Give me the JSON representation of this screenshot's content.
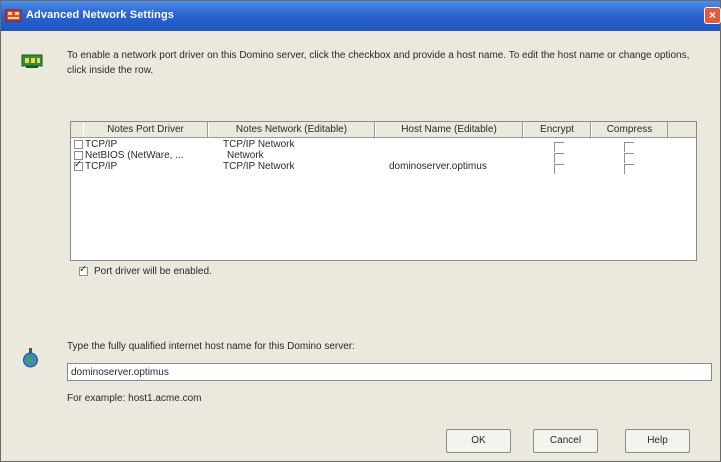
{
  "window": {
    "title": "Advanced Network Settings",
    "close_glyph": "×"
  },
  "intro_text": "To enable a network port driver on this Domino server, click the checkbox and provide a host name. To edit the host name or change options, click inside the row.",
  "table": {
    "headers": [
      "Notes Port Driver",
      "Notes Network (Editable)",
      "Host Name (Editable)",
      "Encrypt",
      "Compress"
    ],
    "rows": [
      {
        "driver": "TCP/IP",
        "network": "TCP/IP Network",
        "host": "",
        "enabled": false,
        "encrypt": false,
        "compress": false
      },
      {
        "driver": "NetBIOS (NetWare, ...",
        "network": "Network",
        "host": "",
        "enabled": false,
        "encrypt": false,
        "compress": false
      },
      {
        "driver": "TCP/IP",
        "network": "TCP/IP Network",
        "host": "dominoserver.optimus",
        "enabled": true,
        "encrypt": false,
        "compress": false
      }
    ]
  },
  "port_driver_label": "Port driver will be enabled.",
  "port_driver_checked": true,
  "host_prompt": "Type the fully qualified internet host name for this Domino server:",
  "host_value": "dominoserver.optimus",
  "example": "For example: host1.acme.com",
  "buttons": {
    "ok": "OK",
    "cancel": "Cancel",
    "help": "Help"
  },
  "icons": {
    "title": "network-settings-icon",
    "network": "network-card-icon",
    "host": "globe-icon"
  },
  "colors": {
    "titlebar": "#2a64d0",
    "dialog_bg": "#ebe8de",
    "close": "#e25a3c"
  }
}
